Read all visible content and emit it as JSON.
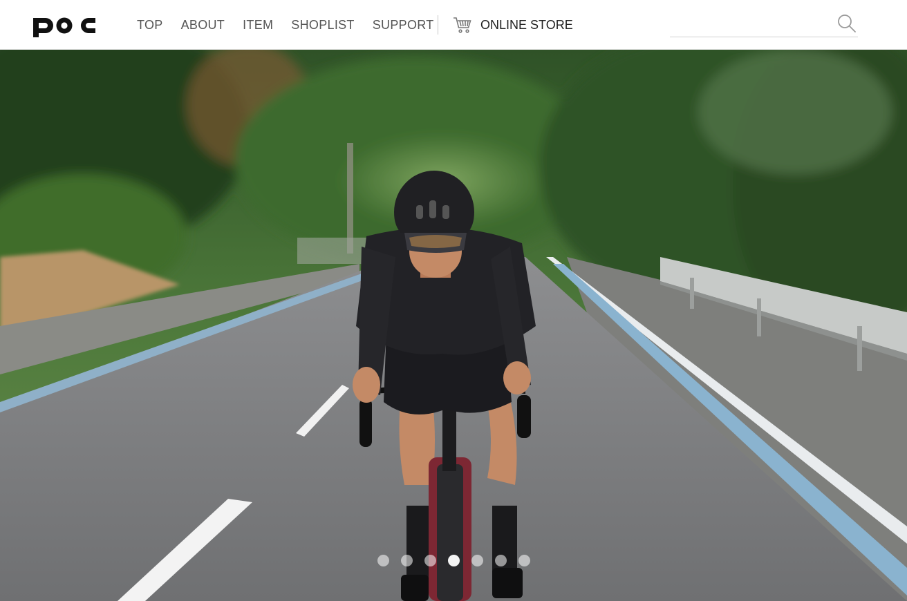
{
  "brand": {
    "logo_text": "poc"
  },
  "nav": {
    "items": [
      {
        "label": "TOP"
      },
      {
        "label": "ABOUT"
      },
      {
        "label": "ITEM"
      },
      {
        "label": "SHOPLIST"
      },
      {
        "label": "SUPPORT"
      }
    ],
    "store": {
      "label": "ONLINE STORE",
      "icon": "cart-icon"
    }
  },
  "search": {
    "value": "",
    "placeholder": "",
    "icon": "search-icon"
  },
  "hero": {
    "carousel": {
      "slide_count": 7,
      "active_index": 3
    }
  },
  "colors": {
    "text_primary": "#222222",
    "text_nav": "#555555",
    "header_bg": "#ffffff"
  }
}
